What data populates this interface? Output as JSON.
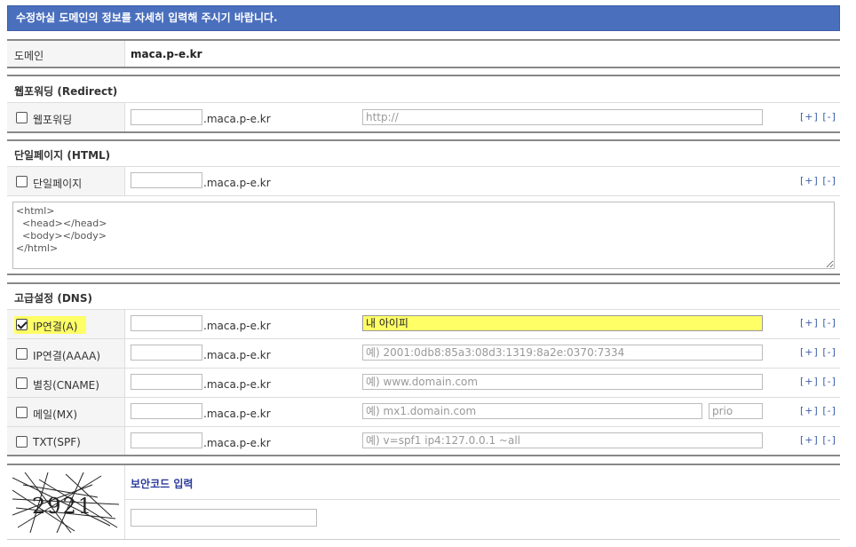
{
  "header": {
    "title": "수정하실 도메인의 정보를 자세히 입력해 주시기 바랍니다."
  },
  "domain": {
    "label": "도메인",
    "value": "maca.p-e.kr"
  },
  "suffix": ".maca.p-e.kr",
  "controls": {
    "plus": "[+]",
    "minus": "[-]"
  },
  "redirect": {
    "section_title": "웹포워딩 (Redirect)",
    "checkbox_label": "웹포워딩",
    "checked": false,
    "subdomain_value": "",
    "url_placeholder": "http://"
  },
  "html_page": {
    "section_title": "단일페이지 (HTML)",
    "checkbox_label": "단일페이지",
    "checked": false,
    "subdomain_value": "",
    "content": "<html>\n  <head></head>\n  <body></body>\n</html>"
  },
  "dns": {
    "section_title": "고급설정 (DNS)",
    "records": [
      {
        "label": "IP연결(A)",
        "checked": true,
        "value": "내 아이피",
        "placeholder": ""
      },
      {
        "label": "IP연결(AAAA)",
        "checked": false,
        "value": "",
        "placeholder": "예) 2001:0db8:85a3:08d3:1319:8a2e:0370:7334"
      },
      {
        "label": "별칭(CNAME)",
        "checked": false,
        "value": "",
        "placeholder": "예) www.domain.com"
      },
      {
        "label": "메일(MX)",
        "checked": false,
        "value": "",
        "placeholder": "예) mx1.domain.com",
        "prio_placeholder": "prio"
      },
      {
        "label": "TXT(SPF)",
        "checked": false,
        "value": "",
        "placeholder": "예) v=spf1 ip4:127.0.0.1 ~all"
      }
    ]
  },
  "captcha": {
    "title": "보안코드 입력",
    "code": "2921",
    "input_value": ""
  },
  "colors": {
    "header_bg": "#4a6fbd",
    "highlight": "#ffff66",
    "link": "#3b5ea8"
  }
}
